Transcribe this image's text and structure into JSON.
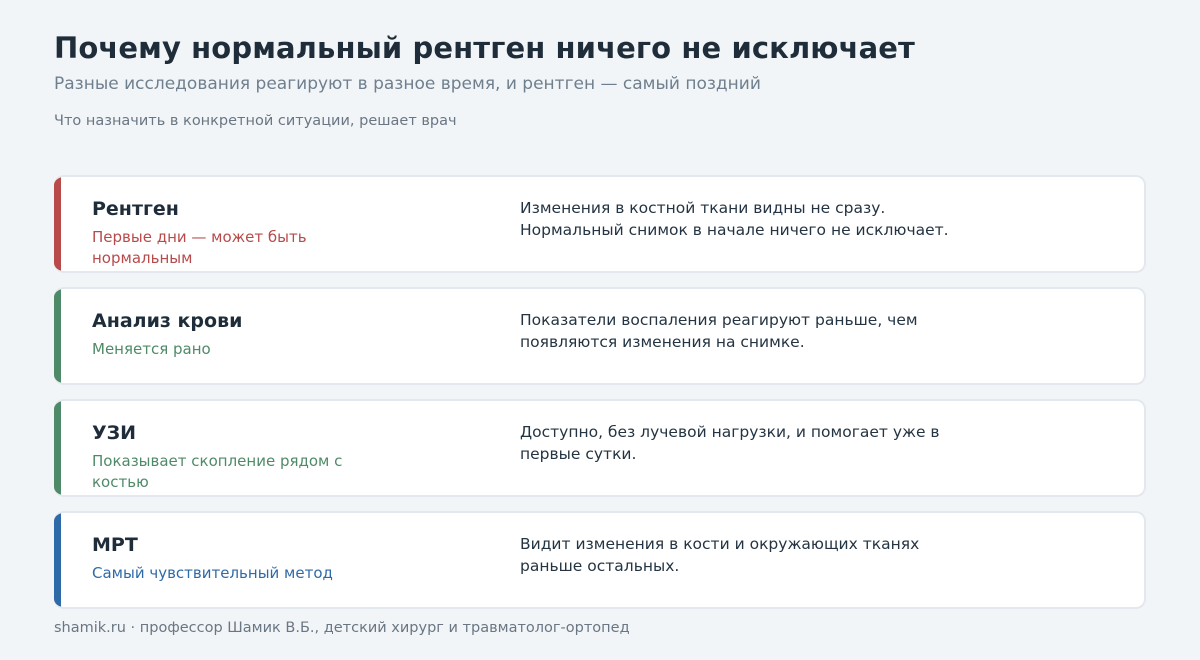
{
  "header": {
    "title": "Почему нормальный рентген ничего не исключает",
    "subtitle": "Разные исследования реагируют в разное время, и рентген — самый поздний",
    "note": "Что назначить в конкретной ситуации, решает врач"
  },
  "cards": [
    {
      "name": "Рентген",
      "status": "Первые дни — может быть нормальным",
      "description": "Изменения в костной ткани видны не сразу. Нормальный снимок в начале ничего не исключает.",
      "color": "#b84a4a"
    },
    {
      "name": "Анализ крови",
      "status": "Меняется рано",
      "description": "Показатели воспаления реагируют раньше, чем появляются изменения на снимке.",
      "color": "#4f8a68"
    },
    {
      "name": "УЗИ",
      "status": "Показывает скопление рядом с костью",
      "description": "Доступно, без лучевой нагрузки, и помогает уже в первые сутки.",
      "color": "#4f8a68"
    },
    {
      "name": "МРТ",
      "status": "Самый чувствительный метод",
      "description": "Видит изменения в кости и окружающих тканях раньше остальных.",
      "color": "#2f6aa8"
    }
  ],
  "footer": {
    "text": "shamik.ru · профессор Шамик В.Б., детский хирург и травматолог-ортопед"
  }
}
